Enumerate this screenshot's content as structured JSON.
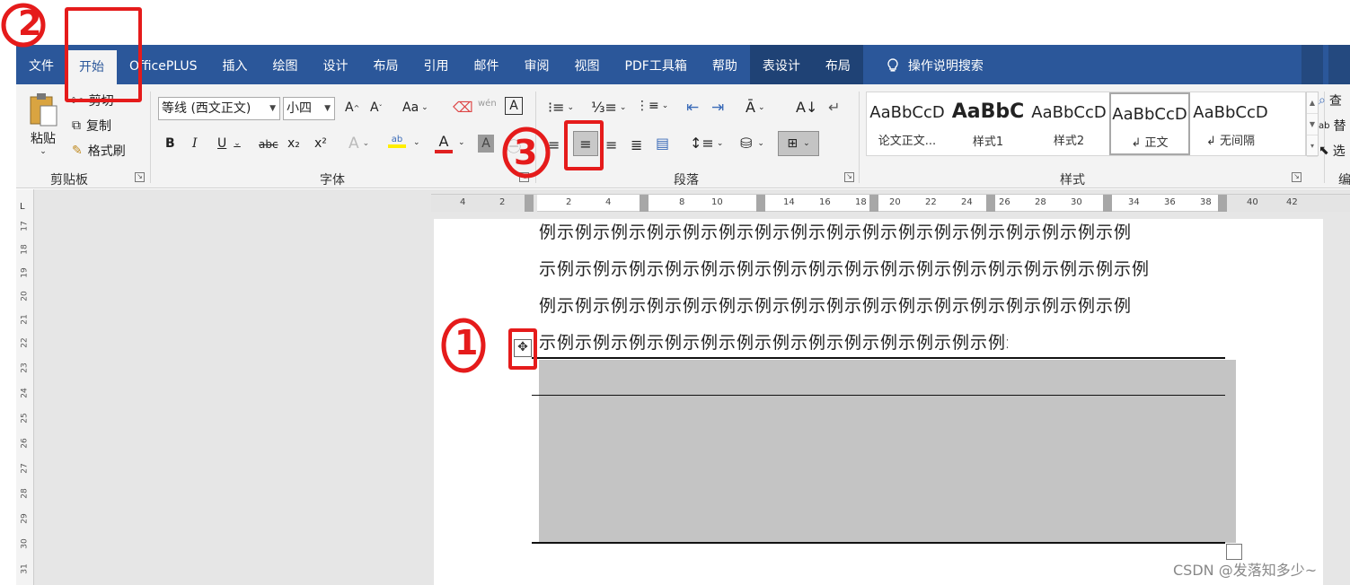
{
  "tabs": [
    "文件",
    "开始",
    "OfficePLUS",
    "插入",
    "绘图",
    "设计",
    "布局",
    "引用",
    "邮件",
    "审阅",
    "视图",
    "PDF工具箱",
    "帮助",
    "表设计",
    "布局",
    "操作说明搜索"
  ],
  "clipboard": {
    "paste": "粘贴",
    "cut": "剪切",
    "copy": "复制",
    "format_painter": "格式刷",
    "group": "剪贴板"
  },
  "font": {
    "name": "等线 (西文正文)",
    "size": "小四",
    "group": "字体",
    "bold": "B",
    "italic": "I",
    "underline": "U",
    "strike": "abc",
    "sub": "x₂",
    "sup": "x²",
    "case": "Aa",
    "grow": "A",
    "shrink": "A",
    "effects": "A",
    "highlight": "ab",
    "color": "A",
    "charshade": "A",
    "phonetic": "wén",
    "border": "A"
  },
  "paragraph": {
    "group": "段落"
  },
  "styles": {
    "group": "样式",
    "items": [
      {
        "sample": "AaBbCcD",
        "name": "论文正文..."
      },
      {
        "sample": "AaBbC",
        "name": "样式1"
      },
      {
        "sample": "AaBbCcD",
        "name": "样式2"
      },
      {
        "sample": "AaBbCcD",
        "name": "↲ 正文"
      },
      {
        "sample": "AaBbCcD",
        "name": "↲ 无间隔"
      }
    ]
  },
  "editing": {
    "find": "查",
    "replace": "替",
    "select": "选",
    "group": "编"
  },
  "doc": {
    "lines": [
      "例示例示例示例示例示例示例示例示例示例示例示例示例示例示例示例示例",
      "示例示例示例示例示例示例示例示例示例示例示例示例示例示例示例示例示例",
      "例示例示例示例示例示例示例示例示例示例示例示例示例示例示例示例示例",
      "示例示例示例示例示例示例示例示例示例示例示例示例示例示例示例示例示例"
    ]
  },
  "hruler_ticks": [
    "4",
    "2",
    "2",
    "4",
    "8",
    "10",
    "14",
    "16",
    "18",
    "20",
    "22",
    "24",
    "26",
    "28",
    "30",
    "34",
    "36",
    "38",
    "40",
    "42"
  ],
  "vruler_ticks": [
    "17",
    "18",
    "19",
    "20",
    "21",
    "22",
    "23",
    "24",
    "25",
    "26",
    "27",
    "28",
    "29",
    "30",
    "31"
  ],
  "watermark": "CSDN @发落知多少~",
  "annotations": {
    "one": "1",
    "two": "2",
    "three": "3"
  },
  "colors": {
    "ribbon": "#2b579a",
    "annotation": "#e51b1b",
    "table_fill": "#c4c4c4"
  }
}
